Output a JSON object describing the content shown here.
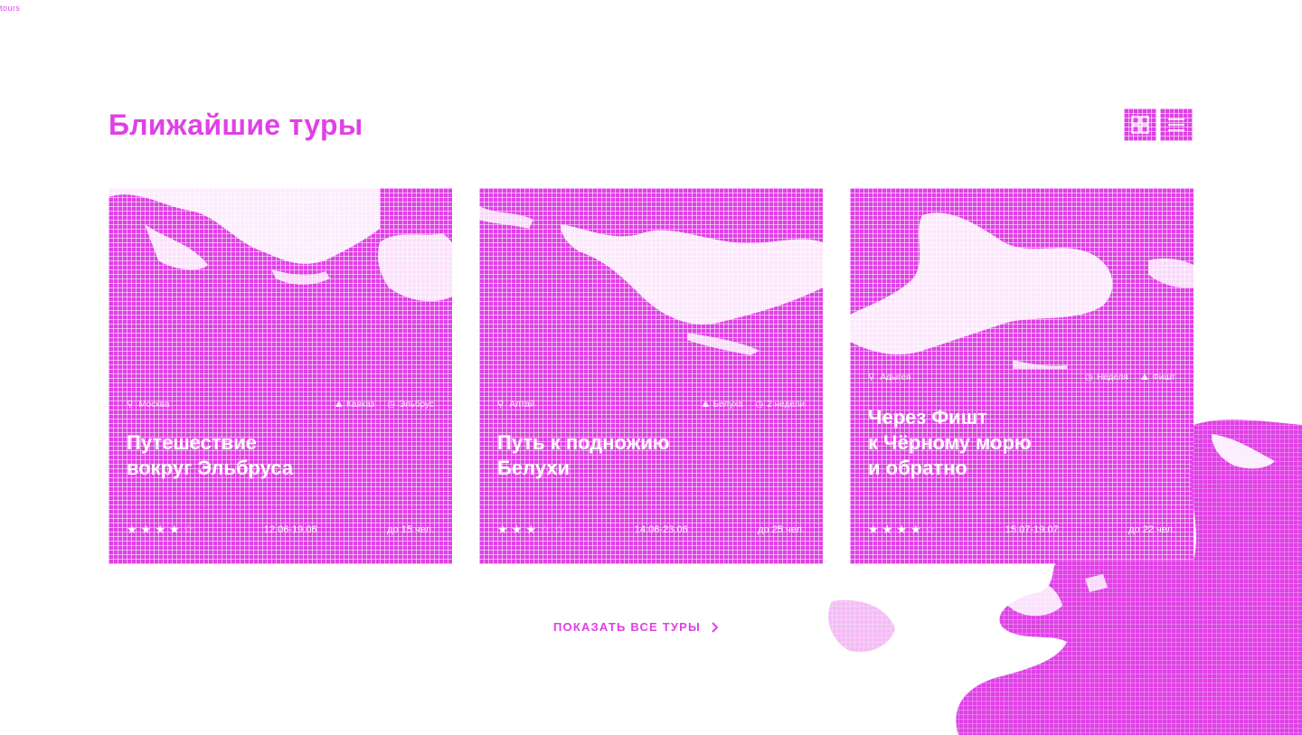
{
  "page": {
    "corner_label": "tours"
  },
  "header": {
    "title": "Ближайшие туры"
  },
  "cards": [
    {
      "location": "Москва",
      "meta_a": "Кавказ",
      "meta_b": "Эльбрус",
      "title": "Путешествие\nвокруг Эльбруса",
      "rating_stars": 4,
      "rating_max": 5,
      "dates": "12.06-19.06",
      "capacity": "до 15 чел."
    },
    {
      "location": "Алтай",
      "meta_a": "Белуха",
      "meta_b": "2 недели",
      "title": "Путь к подножию\nБелухи",
      "rating_stars": 3,
      "rating_max": 5,
      "dates": "14.06-23.06",
      "capacity": "до 25 чел."
    },
    {
      "location": "Адыгея",
      "meta_a": "Неделя",
      "meta_b": "Фишт",
      "title": "Через Фишт\nк Чёрному морю\nи обратно",
      "rating_stars": 4,
      "rating_max": 5,
      "dates": "15.07-19.07",
      "capacity": "до 22 чел."
    }
  ],
  "show_all": {
    "label": "ПОКАЗАТЬ ВСЕ ТУРЫ"
  },
  "colors": {
    "accent": "#e040e6",
    "background": "#ffffff"
  }
}
